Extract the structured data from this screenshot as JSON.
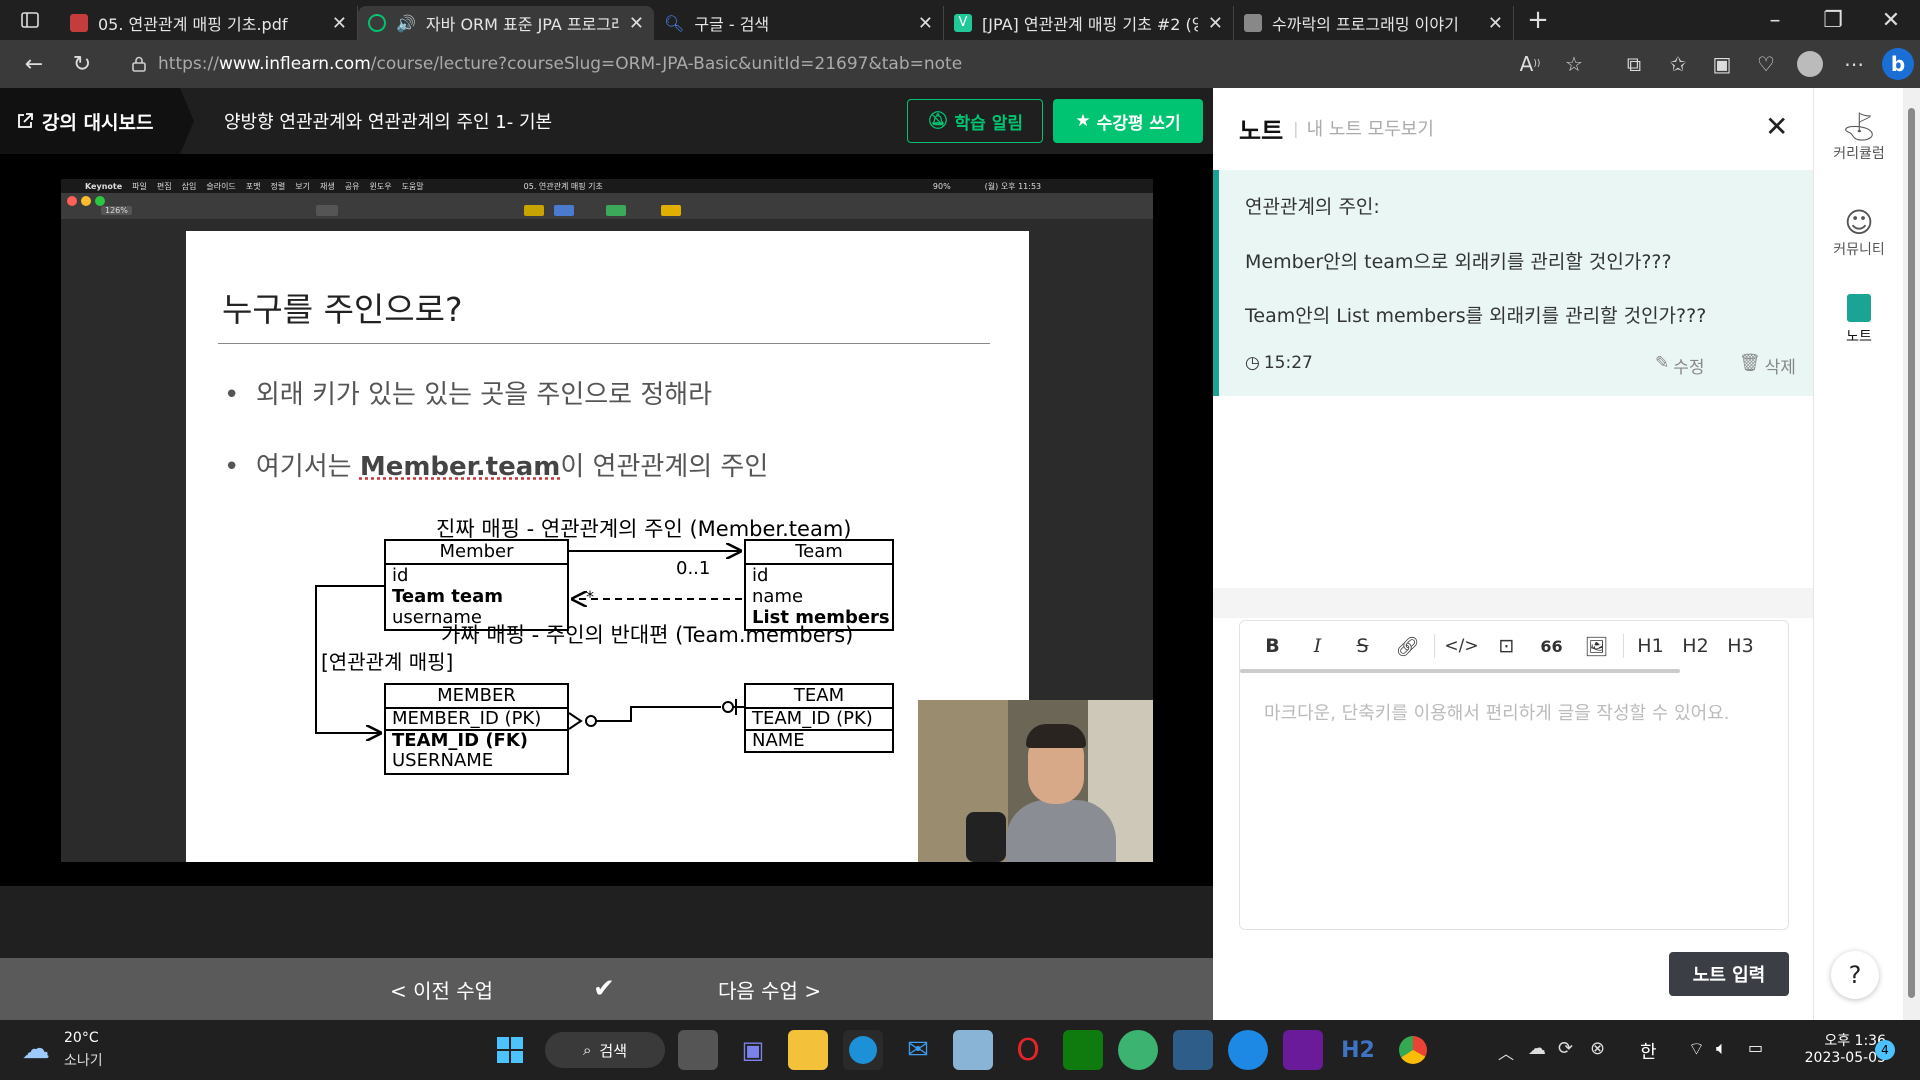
{
  "browser": {
    "tabs": [
      {
        "label": "05. 연관관계 매핑 기초.pdf",
        "active": false
      },
      {
        "label": "자바 ORM 표준 JPA 프로그래",
        "active": true
      },
      {
        "label": "구글 - 검색",
        "active": false
      },
      {
        "label": "[JPA] 연관관계 매핑 기초 #2 (양",
        "active": false
      },
      {
        "label": "수까락의 프로그래밍 이야기",
        "active": false
      }
    ],
    "url_prefix": "https://",
    "url_domain": "www.inflearn.com",
    "url_path": "/course/lecture?courseSlug=ORM-JPA-Basic&unitId=21697&tab=note"
  },
  "lecture": {
    "dashboard_label": "강의 대시보드",
    "title": "양방향 연관관계와 연관관계의 주인 1- 기본",
    "alert_button": "학습 알림",
    "review_button": "수강평 쓰기"
  },
  "keynote": {
    "menu": [
      "Keynote",
      "파일",
      "편집",
      "삽입",
      "슬라이드",
      "포맷",
      "정렬",
      "보기",
      "재생",
      "공유",
      "윈도우",
      "도움말"
    ],
    "doc_title": "05. 연관관계 매핑 기초",
    "zoom": "126%",
    "status_right": "90%",
    "clock": "(월) 오후 11:53"
  },
  "slide": {
    "heading": "누구를 주인으로?",
    "bullet1": "외래 키가 있는 있는 곳을 주인으로 정해라",
    "bullet2_pre": "여기서는 ",
    "bullet2_bold": "Member.team",
    "bullet2_post": "이 연관관계의 주인",
    "real_mapping": "진짜 매핑 - 연관관계의 주인 (Member.team)",
    "fake_mapping": "가짜 매핑 - 주인의 반대편 (Team.members)",
    "mapping_label": "[연관관계 매핑]",
    "member_entity": {
      "name": "Member",
      "fields": [
        "id",
        "Team team",
        "username"
      ]
    },
    "team_entity": {
      "name": "Team",
      "fields": [
        "id",
        "name",
        "List members"
      ]
    },
    "multiplicity_one": "0..1",
    "multiplicity_many": "*",
    "member_table": {
      "name": "MEMBER",
      "pk": "MEMBER_ID (PK)",
      "fields": [
        "TEAM_ID (FK)",
        "USERNAME"
      ]
    },
    "team_table": {
      "name": "TEAM",
      "pk": "TEAM_ID (PK)",
      "fields": [
        "NAME"
      ]
    }
  },
  "bottom_nav": {
    "prev": "< 이전 수업",
    "next": "다음 수업 >"
  },
  "notes": {
    "title": "노트",
    "view_all": "내 노트 모두보기",
    "line1": "연관관계의 주인:",
    "line2": "Member안의 team으로 외래키를 관리할 것인가???",
    "line3": "Team안의 List members를 외래키를 관리할 것인가???",
    "timestamp": "15:27",
    "edit": "수정",
    "delete": "삭제",
    "editor_tools": [
      "B",
      "I",
      "S",
      "link",
      "</>",
      "code-block",
      "66",
      "image",
      "H1",
      "H2",
      "H3"
    ],
    "placeholder": "마크다운, 단축키를 이용해서 편리하게 글을 작성할 수 있어요.",
    "submit": "노트 입력"
  },
  "sidebar": {
    "items": [
      "커리큘럼",
      "커뮤니티",
      "노트"
    ],
    "help": "?"
  },
  "taskbar": {
    "weather_temp": "20°C",
    "weather_desc": "소나기",
    "search_label": "검색",
    "ime": "한",
    "time": "오후 1:36",
    "date": "2023-05-05",
    "badge": "4"
  },
  "colors": {
    "accent_green": "#00c471",
    "note_teal": "#1ba493"
  }
}
